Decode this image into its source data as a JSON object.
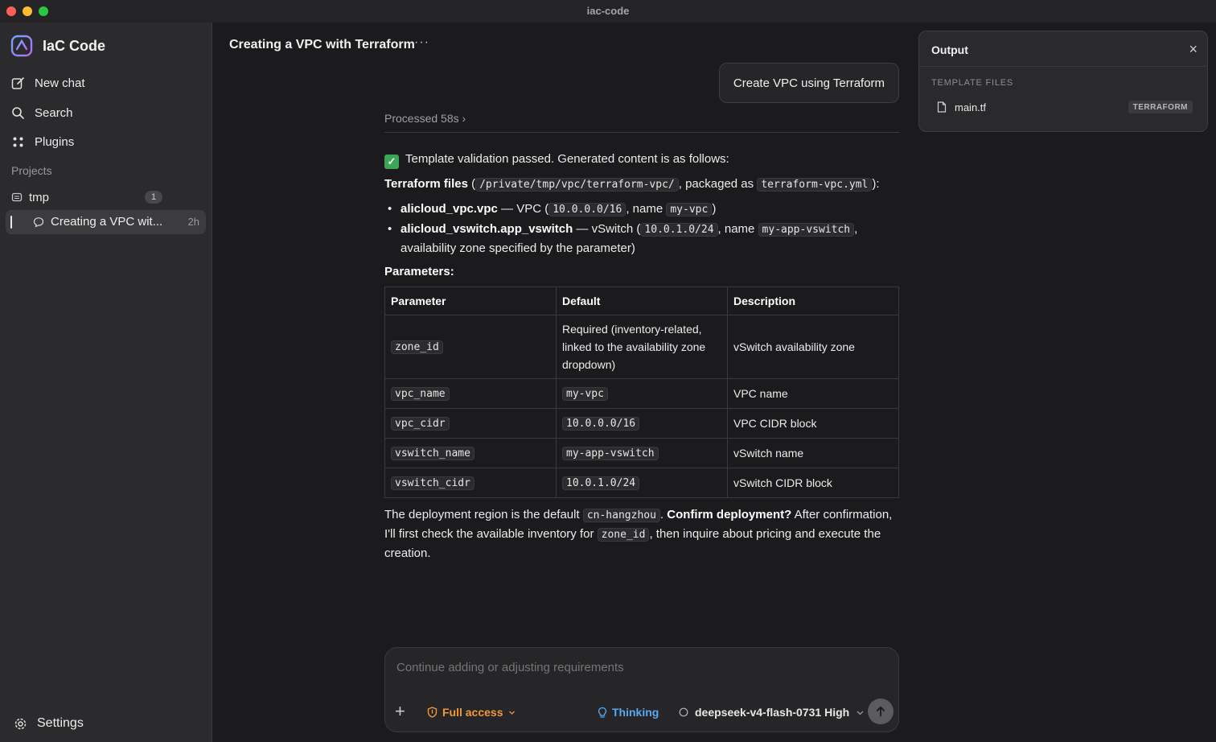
{
  "window": {
    "title": "iac-code"
  },
  "sidebar": {
    "brand": "IaC Code",
    "nav": [
      {
        "label": "New chat",
        "icon": "new-chat-icon"
      },
      {
        "label": "Search",
        "icon": "search-icon"
      },
      {
        "label": "Plugins",
        "icon": "plugins-icon"
      }
    ],
    "projects_label": "Projects",
    "project": {
      "name": "tmp",
      "count": "1"
    },
    "chat": {
      "title": "Creating a VPC wit...",
      "time": "2h"
    },
    "settings_label": "Settings"
  },
  "main": {
    "chat_title": "Creating a VPC with Terraform",
    "more": "···",
    "user_message": "Create VPC using Terraform",
    "processed": "Processed 58s ›",
    "validation": "Template validation passed. Generated content is as follows:",
    "files_intro": {
      "label": "Terraform files",
      "open": " (",
      "path": "/private/tmp/vpc/terraform-vpc/",
      "mid": ", packaged as ",
      "pkg": "terraform-vpc.yml",
      "close": "):"
    },
    "bullets": [
      {
        "name": "alicloud_vpc.vpc",
        "t1": " — VPC (",
        "c1": "10.0.0.0/16",
        "t2": ", name ",
        "c2": "my-vpc",
        "t3": ")"
      },
      {
        "name": "alicloud_vswitch.app_vswitch",
        "t1": " — vSwitch (",
        "c1": "10.0.1.0/24",
        "t2": ", name ",
        "c2": "my-app-vswitch",
        "t3": ", availability zone specified by the parameter)"
      }
    ],
    "params_label": "Parameters:",
    "table": {
      "headers": [
        "Parameter",
        "Default",
        "Description"
      ],
      "rows": [
        {
          "param": "zone_id",
          "default": "Required (inventory-related, linked to the availability zone dropdown)",
          "default_is_code": false,
          "desc": "vSwitch availability zone"
        },
        {
          "param": "vpc_name",
          "default": "my-vpc",
          "default_is_code": true,
          "desc": "VPC name"
        },
        {
          "param": "vpc_cidr",
          "default": "10.0.0.0/16",
          "default_is_code": true,
          "desc": "VPC CIDR block"
        },
        {
          "param": "vswitch_name",
          "default": "my-app-vswitch",
          "default_is_code": true,
          "desc": "vSwitch name"
        },
        {
          "param": "vswitch_cidr",
          "default": "10.0.1.0/24",
          "default_is_code": true,
          "desc": "vSwitch CIDR block"
        }
      ]
    },
    "closing": {
      "t1": "The deployment region is the default ",
      "region": "cn-hangzhou",
      "t2": ". ",
      "bold": "Confirm deployment?",
      "t3": " After confirmation, I'll first check the available inventory for ",
      "zone": "zone_id",
      "t4": ", then inquire about pricing and execute the creation."
    }
  },
  "composer": {
    "placeholder": "Continue adding or adjusting requirements",
    "access_label": "Full access",
    "thinking_label": "Thinking",
    "model_label": "deepseek-v4-flash-0731 High"
  },
  "output": {
    "title": "Output",
    "section_label": "TEMPLATE FILES",
    "file_name": "main.tf",
    "file_badge": "TERRAFORM"
  },
  "colors": {
    "access": "#f0983a",
    "thinking": "#5aa8f0",
    "check": "#3aa757"
  }
}
